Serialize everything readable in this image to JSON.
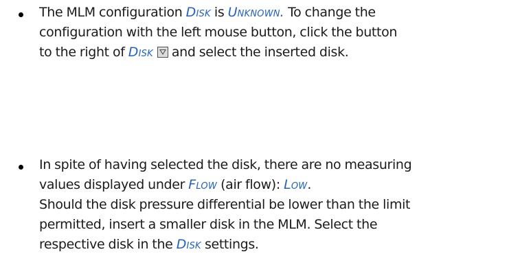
{
  "items": [
    {
      "line1_prefix": "The MLM configuration ",
      "kw_disk": "Disk",
      "line1_mid": " is ",
      "kw_unknown": "Unknown.",
      "line1_suffix": " To change the",
      "line2": "configuration with the left mouse button, click the button",
      "line3_prefix": "to the right of ",
      "kw_disk2": "Disk",
      "dropdown_icon": "dropdown-arrow-button",
      "line3_suffix": "and select the inserted disk."
    },
    {
      "line1": "In spite of having selected the disk, there are no measuring",
      "line2_prefix": "values displayed under ",
      "kw_flow": "Flow",
      "line2_mid": " (air flow): ",
      "kw_low": "Low",
      "line2_suffix": ".",
      "line3": "Should the disk pressure differential be lower than the limit",
      "line4": "permitted, insert a smaller disk in the MLM. Select the",
      "line5_prefix": "respective disk in the ",
      "kw_disk": "Disk",
      "line5_suffix": " settings."
    }
  ],
  "colors": {
    "keyword": "#1f5fd6",
    "text": "#1a1a1a"
  }
}
